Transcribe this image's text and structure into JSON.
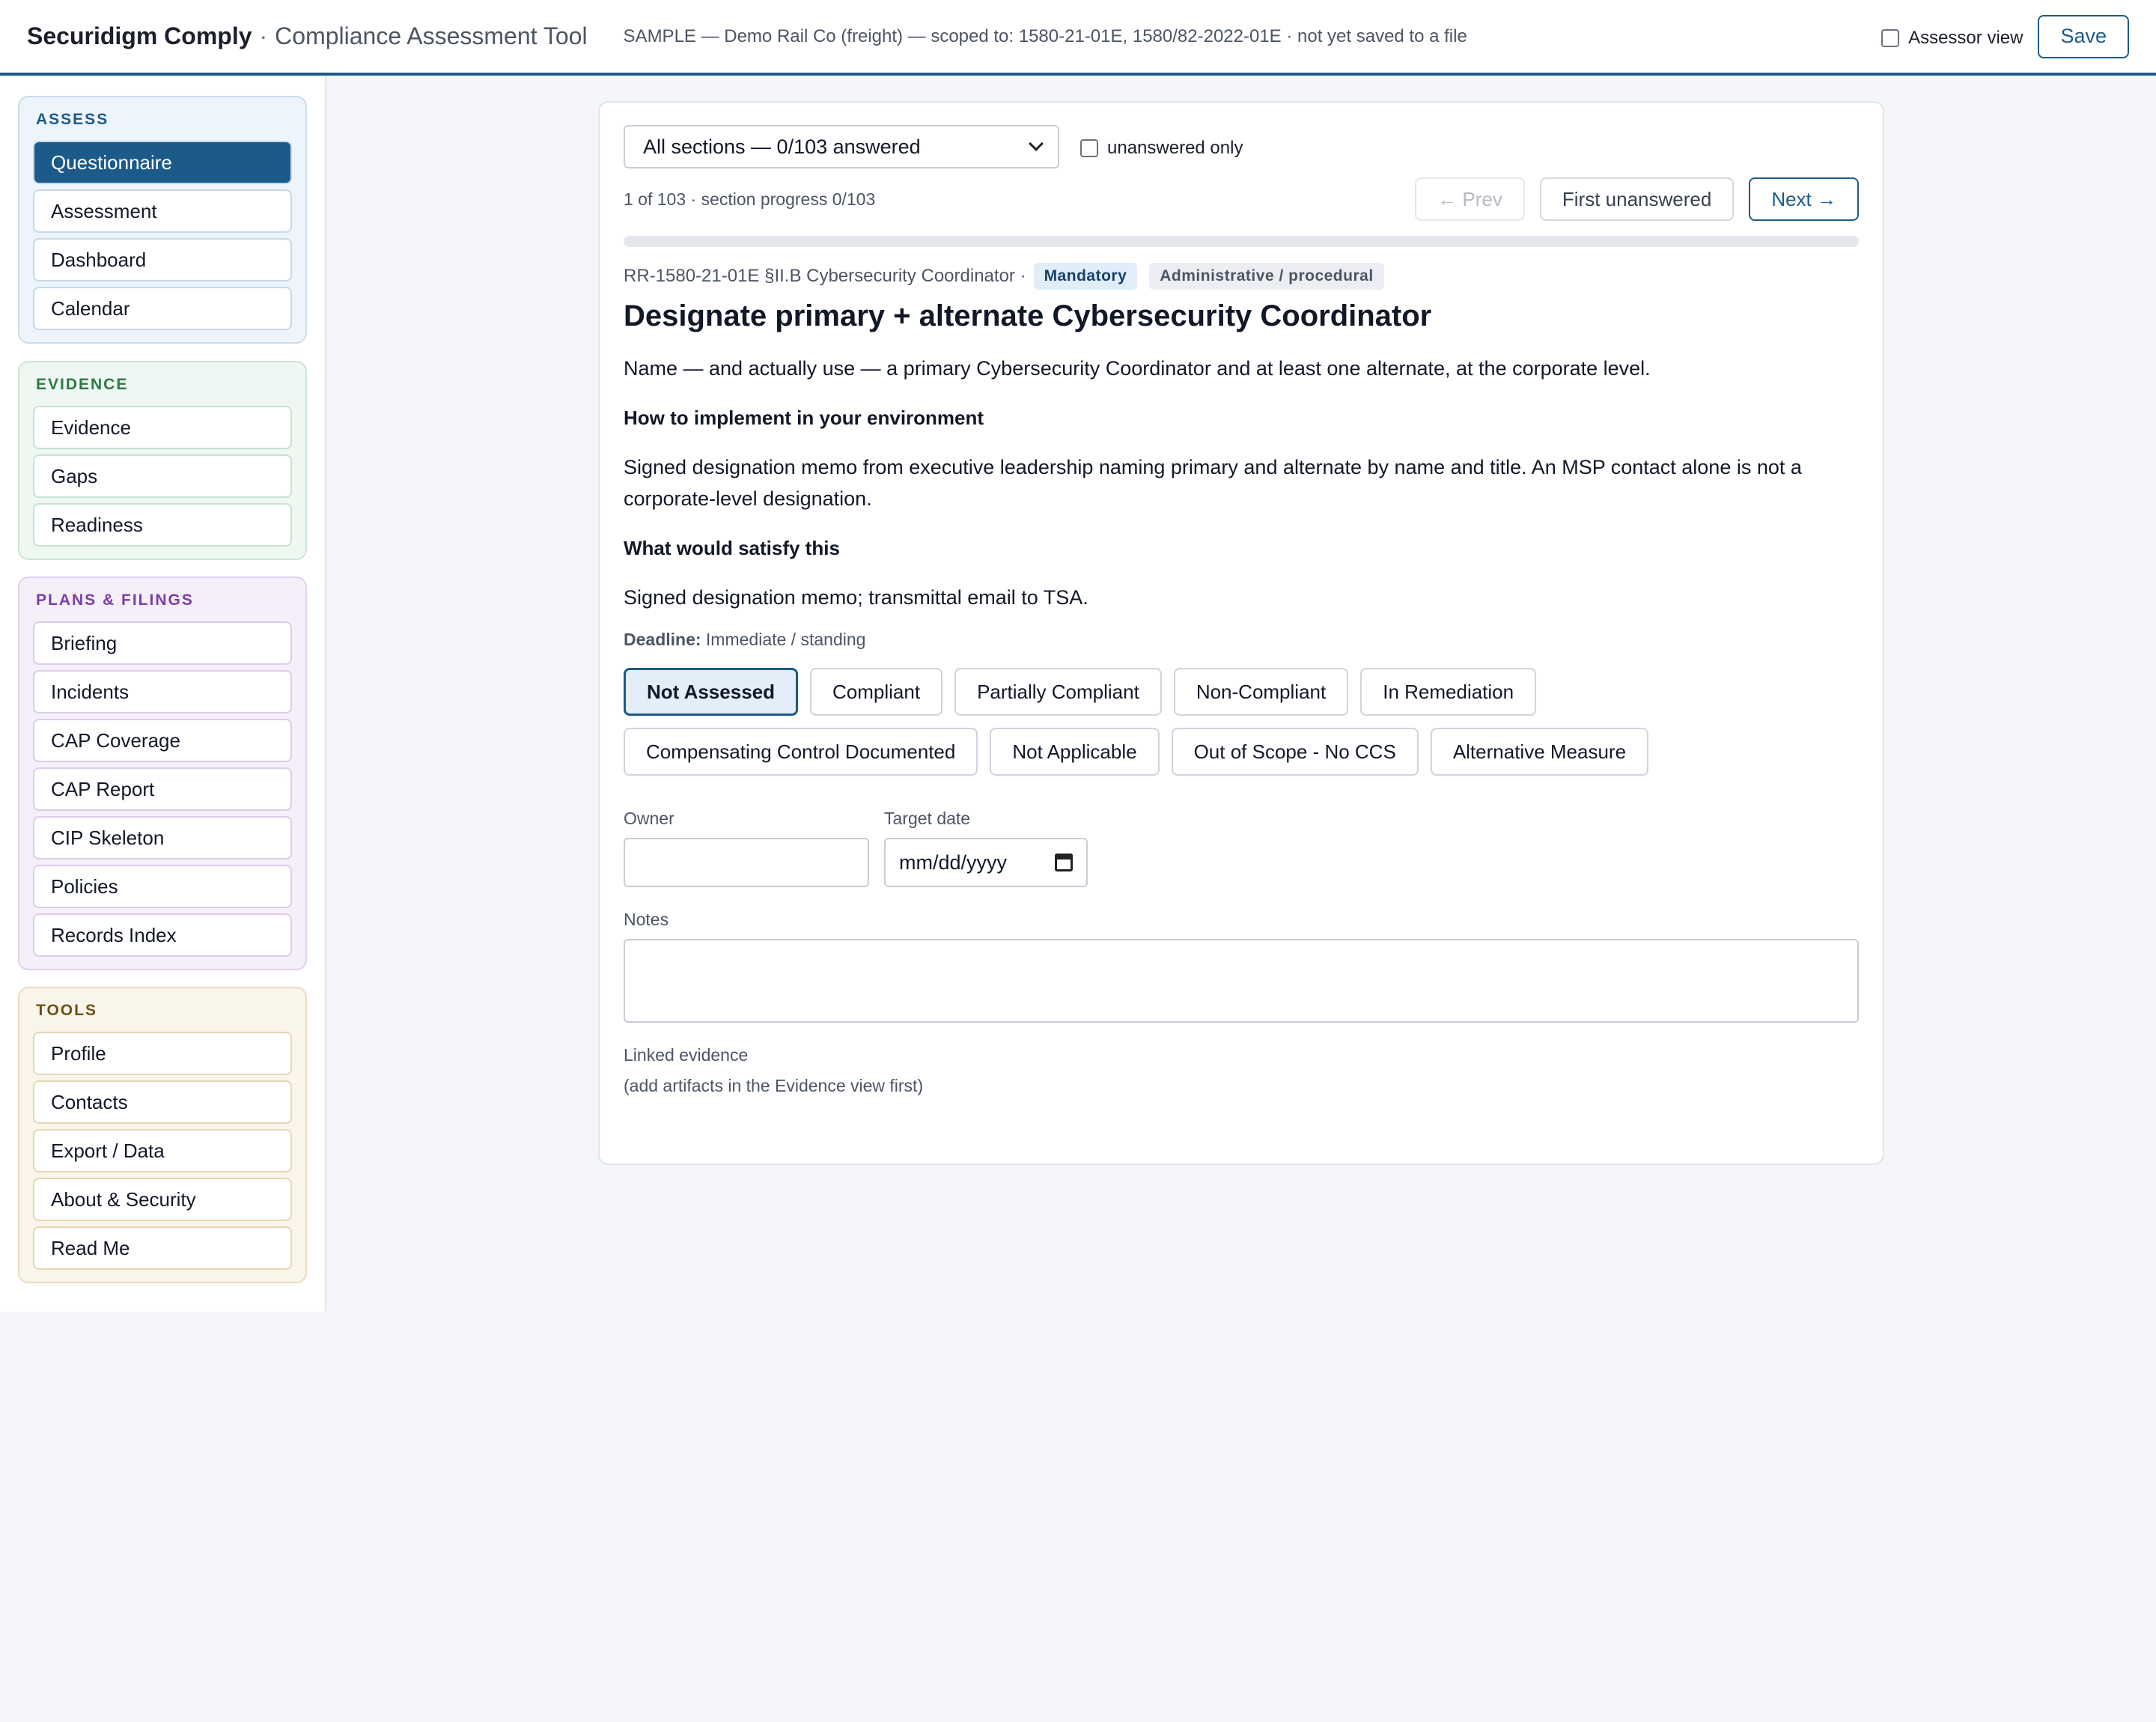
{
  "header": {
    "brand": "Securidigm Comply",
    "separator": "·",
    "subtitle": "Compliance Assessment Tool",
    "status": "SAMPLE — Demo Rail Co (freight) — scoped to: 1580-21-01E, 1580/82-2022-01E · not yet saved to a file",
    "assessor_label": "Assessor view",
    "save_label": "Save"
  },
  "sidebar": {
    "groups": [
      {
        "title": "ASSESS",
        "items": [
          "Questionnaire",
          "Assessment",
          "Dashboard",
          "Calendar"
        ],
        "active": 0
      },
      {
        "title": "EVIDENCE",
        "items": [
          "Evidence",
          "Gaps",
          "Readiness"
        ]
      },
      {
        "title": "PLANS & FILINGS",
        "items": [
          "Briefing",
          "Incidents",
          "CAP Coverage",
          "CAP Report",
          "CIP Skeleton",
          "Policies",
          "Records Index"
        ]
      },
      {
        "title": "TOOLS",
        "items": [
          "Profile",
          "Contacts",
          "Export / Data",
          "About & Security",
          "Read Me"
        ]
      }
    ]
  },
  "main": {
    "section_select": "All sections — 0/103 answered",
    "unanswered_only": "unanswered only",
    "progress_text": "1 of 103 · section progress 0/103",
    "progress_fraction": 0,
    "prev_label": "← Prev",
    "first_unanswered_label": "First unanswered",
    "next_label": "Next →",
    "ref": "RR-1580-21-01E §II.B Cybersecurity Coordinator ·",
    "tag_mandatory": "Mandatory",
    "tag_category": "Administrative / procedural",
    "title": "Designate primary + alternate Cybersecurity Coordinator",
    "description": "Name — and actually use — a primary Cybersecurity Coordinator and at least one alternate, at the corporate level.",
    "how_heading": "How to implement in your environment",
    "how_text": "Signed designation memo from executive leadership naming primary and alternate by name and title. An MSP contact alone is not a corporate-level designation.",
    "satisfy_heading": "What would satisfy this",
    "satisfy_text": "Signed designation memo; transmittal email to TSA.",
    "deadline_label": "Deadline:",
    "deadline_value": "Immediate / standing",
    "statuses": [
      "Not Assessed",
      "Compliant",
      "Partially Compliant",
      "Non-Compliant",
      "In Remediation",
      "Compensating Control Documented",
      "Not Applicable",
      "Out of Scope - No CCS",
      "Alternative Measure"
    ],
    "selected_status": 0,
    "owner_label": "Owner",
    "owner_value": "",
    "target_date_label": "Target date",
    "target_date_placeholder": "mm/dd/yyyy",
    "notes_label": "Notes",
    "notes_value": "",
    "linked_label": "Linked evidence",
    "linked_note": "(add artifacts in the Evidence view first)"
  },
  "colors": {
    "accent": "#1c5a8a",
    "assess": "#1c5a8a",
    "evidence": "#2b7a44",
    "plans": "#7a3ea8",
    "tools": "#6b5316"
  }
}
